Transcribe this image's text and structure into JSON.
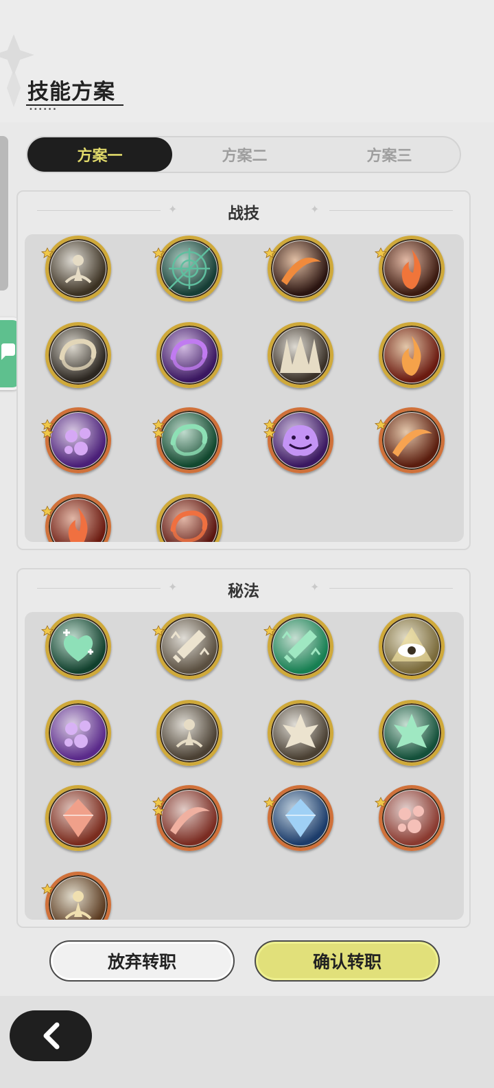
{
  "header": {
    "title": "技能方案"
  },
  "tabs": [
    {
      "label": "方案一",
      "active": true
    },
    {
      "label": "方案二",
      "active": false
    },
    {
      "label": "方案三",
      "active": false
    }
  ],
  "sections": [
    {
      "title": "战技"
    },
    {
      "title": "秘法"
    }
  ],
  "buttons": {
    "cancel": "放弃转职",
    "confirm": "确认转职"
  },
  "colors": {
    "tab_active_bg": "#1e1e1e",
    "tab_active_text": "#e0d96a",
    "confirm_bg": "#e1e07a",
    "gold_ring": "#cfa93a",
    "orange_ring": "#d0713a"
  },
  "skills_combat": [
    {
      "icon": "dodge-figure-icon",
      "rarity": 1
    },
    {
      "icon": "web-icon",
      "rarity": 1
    },
    {
      "icon": "fire-slash-icon",
      "rarity": 1
    },
    {
      "icon": "flame-burst-icon",
      "rarity": 1
    },
    {
      "icon": "whirl-slash-icon",
      "rarity": 0
    },
    {
      "icon": "purple-swirl-icon",
      "rarity": 0
    },
    {
      "icon": "spike-trap-icon",
      "rarity": 0
    },
    {
      "icon": "fire-shield-icon",
      "rarity": 0
    },
    {
      "icon": "purple-roses-icon",
      "rarity": 2
    },
    {
      "icon": "green-vortex-icon",
      "rarity": 2
    },
    {
      "icon": "ghost-grin-icon",
      "rarity": 2
    },
    {
      "icon": "fire-sweep-icon",
      "rarity": 1
    },
    {
      "icon": "fire-nova-icon",
      "rarity": 1
    },
    {
      "icon": "lava-swirl-icon",
      "rarity": 0
    }
  ],
  "skills_arcane": [
    {
      "icon": "heart-heal-icon",
      "rarity": 1
    },
    {
      "icon": "sword-buff-icon",
      "rarity": 1
    },
    {
      "icon": "green-blade-icon",
      "rarity": 1
    },
    {
      "icon": "eye-pyramid-icon",
      "rarity": 0
    },
    {
      "icon": "purple-orb-icon",
      "rarity": 0
    },
    {
      "icon": "shield-figure-icon",
      "rarity": 0
    },
    {
      "icon": "maple-leaf-icon",
      "rarity": 0
    },
    {
      "icon": "leaf-orb-icon",
      "rarity": 0
    },
    {
      "icon": "red-crystal-icon",
      "rarity": 0
    },
    {
      "icon": "red-wind-icon",
      "rarity": 2
    },
    {
      "icon": "blue-crest-icon",
      "rarity": 1
    },
    {
      "icon": "pink-flower-icon",
      "rarity": 1
    },
    {
      "icon": "shadow-figure-icon",
      "rarity": 1
    }
  ]
}
